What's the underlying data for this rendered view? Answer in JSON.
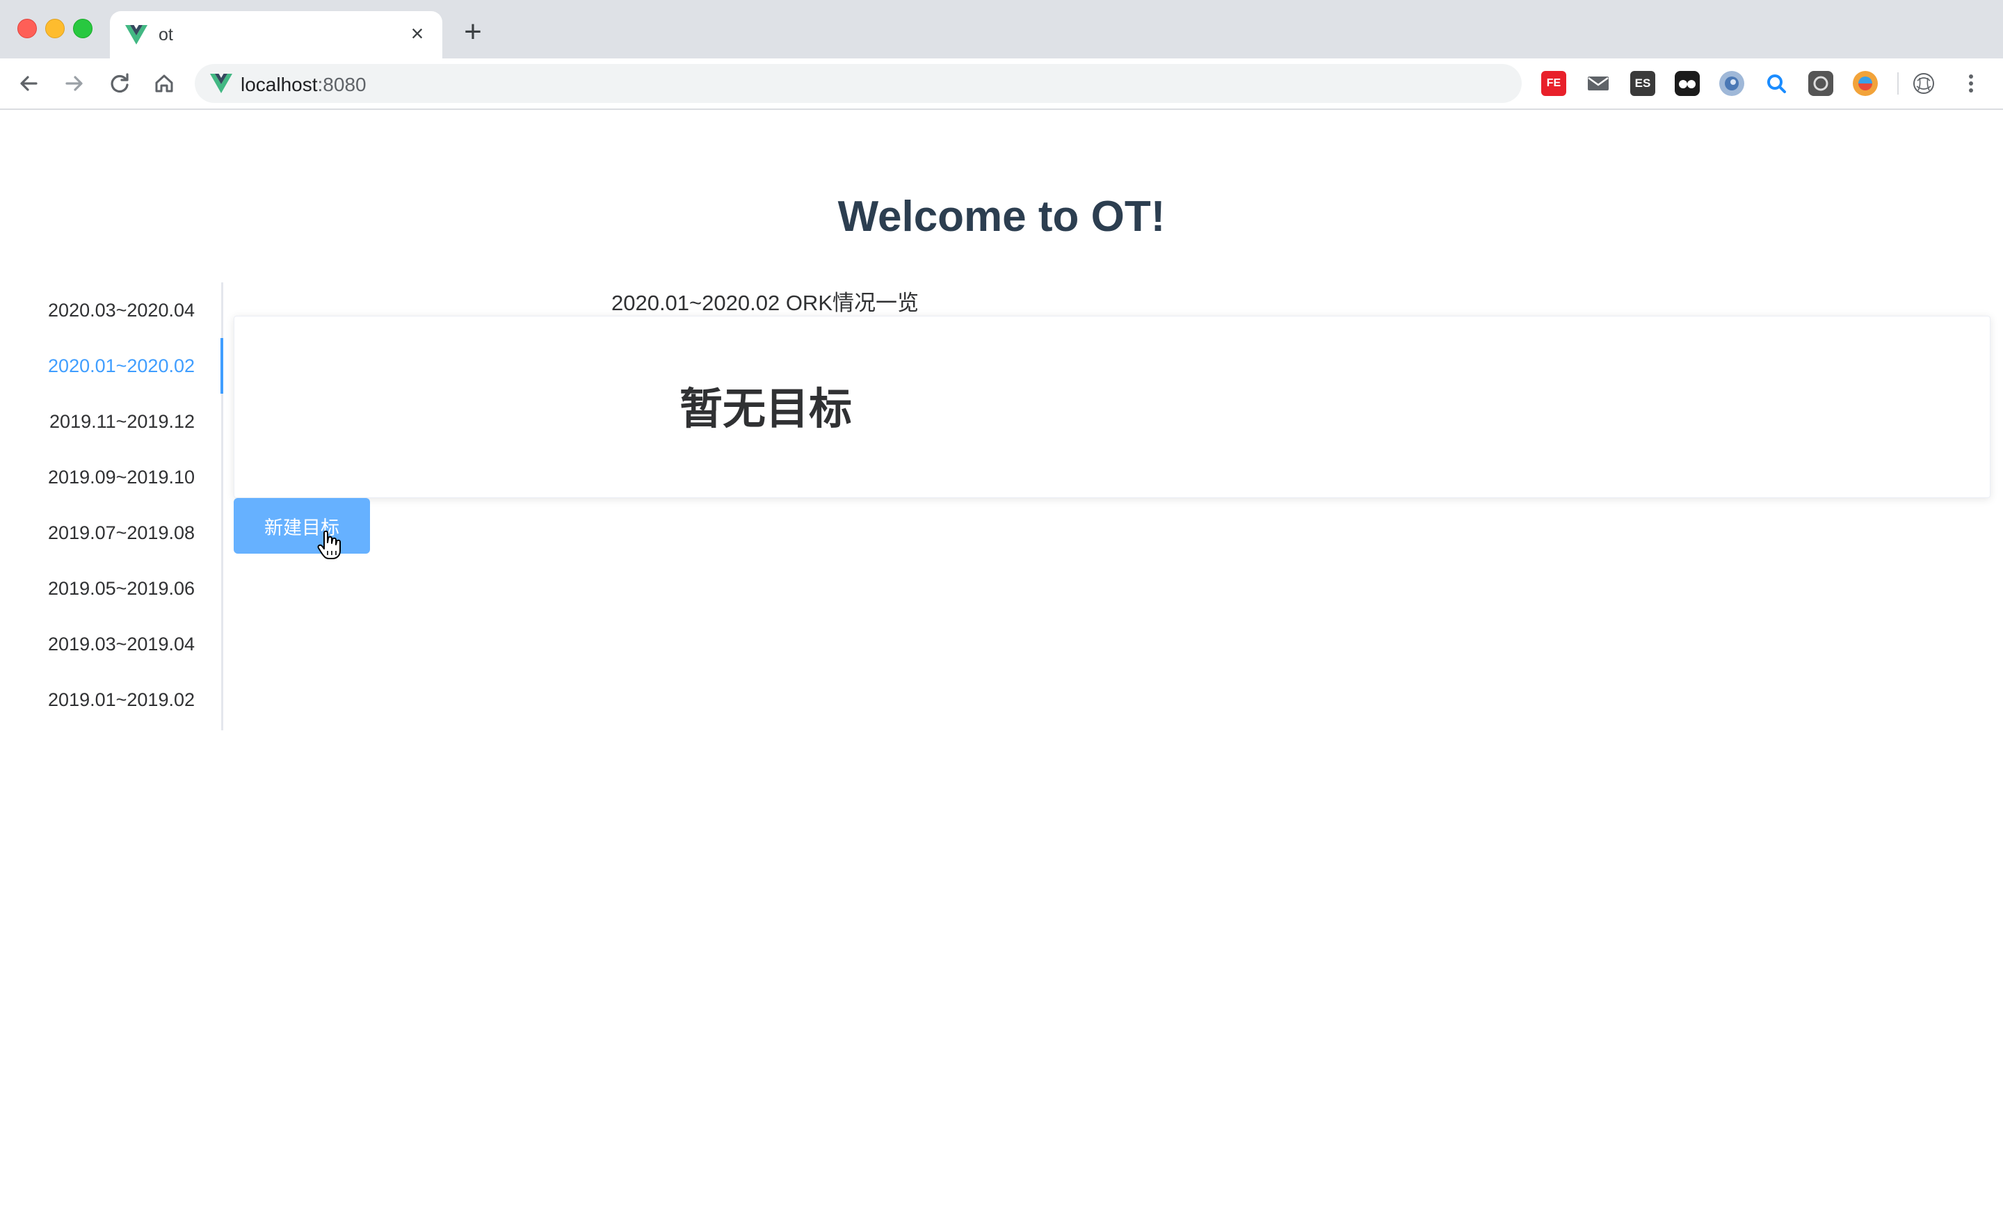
{
  "browser": {
    "tab_title": "ot",
    "tab_close": "×",
    "new_tab": "+",
    "url_host": "localhost",
    "url_port": ":8080",
    "extensions": {
      "fe": "FE",
      "es": "ES"
    }
  },
  "page": {
    "title": "Welcome to OT!",
    "caption": "2020.01~2020.02 ORK情况一览",
    "empty_message": "暂无目标",
    "new_goal_button": "新建目标"
  },
  "timeline": {
    "items": [
      {
        "label": "2020.03~2020.04",
        "active": false
      },
      {
        "label": "2020.01~2020.02",
        "active": true
      },
      {
        "label": "2019.11~2019.12",
        "active": false
      },
      {
        "label": "2019.09~2019.10",
        "active": false
      },
      {
        "label": "2019.07~2019.08",
        "active": false
      },
      {
        "label": "2019.05~2019.06",
        "active": false
      },
      {
        "label": "2019.03~2019.04",
        "active": false
      },
      {
        "label": "2019.01~2019.02",
        "active": false
      }
    ]
  },
  "colors": {
    "accent": "#409eff",
    "button": "#66b1ff",
    "title": "#2c3e50",
    "vue_green": "#42b883",
    "vue_dark": "#35495e"
  }
}
